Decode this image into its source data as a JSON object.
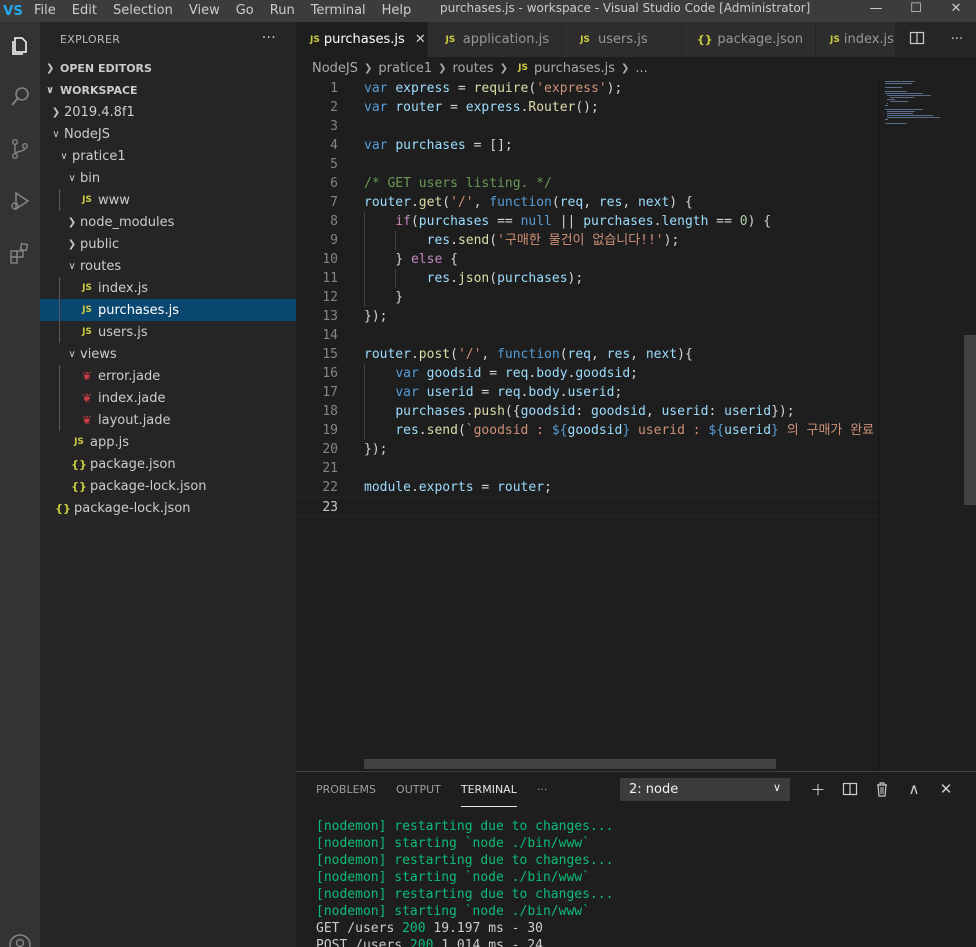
{
  "titlebar": {
    "logo": "VS",
    "menu": [
      "File",
      "Edit",
      "Selection",
      "View",
      "Go",
      "Run",
      "Terminal",
      "Help"
    ],
    "title": "purchases.js - workspace - Visual Studio Code [Administrator]",
    "controls": [
      "minimize-icon",
      "maximize-icon",
      "close-icon"
    ]
  },
  "activitybar": [
    "files-icon",
    "search-icon",
    "source-control-icon",
    "run-debug-icon",
    "extensions-icon",
    "account-icon"
  ],
  "sidebar": {
    "header": "EXPLORER",
    "more": "···",
    "sections": {
      "open_editors": "OPEN EDITORS",
      "workspace": "WORKSPACE"
    },
    "tree": [
      {
        "label": "2019.4.8f1",
        "kind": "folder",
        "expanded": false
      },
      {
        "label": "NodeJS",
        "kind": "folder",
        "expanded": true
      },
      {
        "label": "pratice1",
        "kind": "folder",
        "expanded": true
      },
      {
        "label": "bin",
        "kind": "folder",
        "expanded": true
      },
      {
        "label": "www",
        "kind": "js"
      },
      {
        "label": "node_modules",
        "kind": "folder",
        "expanded": false
      },
      {
        "label": "public",
        "kind": "folder",
        "expanded": false
      },
      {
        "label": "routes",
        "kind": "folder",
        "expanded": true
      },
      {
        "label": "index.js",
        "kind": "js"
      },
      {
        "label": "purchases.js",
        "kind": "js",
        "selected": true
      },
      {
        "label": "users.js",
        "kind": "js"
      },
      {
        "label": "views",
        "kind": "folder",
        "expanded": true
      },
      {
        "label": "error.jade",
        "kind": "jade"
      },
      {
        "label": "index.jade",
        "kind": "jade"
      },
      {
        "label": "layout.jade",
        "kind": "jade"
      },
      {
        "label": "app.js",
        "kind": "js"
      },
      {
        "label": "package.json",
        "kind": "json"
      },
      {
        "label": "package-lock.json",
        "kind": "json"
      },
      {
        "label": "package-lock.json",
        "kind": "json"
      }
    ]
  },
  "tabs": [
    {
      "label": "purchases.js",
      "icon": "JS",
      "active": true,
      "close": "✕"
    },
    {
      "label": "application.js",
      "icon": "JS"
    },
    {
      "label": "users.js",
      "icon": "JS"
    },
    {
      "label": "package.json",
      "icon": "{}"
    },
    {
      "label": "index.js",
      "icon": "JS"
    }
  ],
  "breadcrumb": [
    "NodeJS",
    "pratice1",
    "routes",
    "purchases.js",
    "..."
  ],
  "breadcrumb_file_icon": "JS",
  "editor": {
    "current_line": 23,
    "lines": [
      [
        [
          "kw",
          "var"
        ],
        [
          "t",
          " "
        ],
        [
          "var",
          "express"
        ],
        [
          "t",
          " = "
        ],
        [
          "fn",
          "require"
        ],
        [
          "t",
          "("
        ],
        [
          "str",
          "'express'"
        ],
        [
          "t",
          ");"
        ]
      ],
      [
        [
          "kw",
          "var"
        ],
        [
          "t",
          " "
        ],
        [
          "var",
          "router"
        ],
        [
          "t",
          " = "
        ],
        [
          "var",
          "express"
        ],
        [
          "t",
          "."
        ],
        [
          "fn",
          "Router"
        ],
        [
          "t",
          "();"
        ]
      ],
      [],
      [
        [
          "kw",
          "var"
        ],
        [
          "t",
          " "
        ],
        [
          "var",
          "purchases"
        ],
        [
          "t",
          " = [];"
        ]
      ],
      [],
      [
        [
          "cm",
          "/* GET users listing. */"
        ]
      ],
      [
        [
          "var",
          "router"
        ],
        [
          "t",
          "."
        ],
        [
          "fn",
          "get"
        ],
        [
          "t",
          "("
        ],
        [
          "str",
          "'/'"
        ],
        [
          "t",
          ", "
        ],
        [
          "kw",
          "function"
        ],
        [
          "t",
          "("
        ],
        [
          "var",
          "req"
        ],
        [
          "t",
          ", "
        ],
        [
          "var",
          "res"
        ],
        [
          "t",
          ", "
        ],
        [
          "var",
          "next"
        ],
        [
          "t",
          ") {"
        ]
      ],
      [
        [
          "t",
          "    "
        ],
        [
          "ctl",
          "if"
        ],
        [
          "t",
          "("
        ],
        [
          "var",
          "purchases"
        ],
        [
          "t",
          " == "
        ],
        [
          "kw",
          "null"
        ],
        [
          "t",
          " || "
        ],
        [
          "var",
          "purchases"
        ],
        [
          "t",
          "."
        ],
        [
          "var",
          "length"
        ],
        [
          "t",
          " == "
        ],
        [
          "num",
          "0"
        ],
        [
          "t",
          ") {"
        ]
      ],
      [
        [
          "t",
          "        "
        ],
        [
          "var",
          "res"
        ],
        [
          "t",
          "."
        ],
        [
          "fn",
          "send"
        ],
        [
          "t",
          "("
        ],
        [
          "str",
          "'구매한 물건이 없습니다!!'"
        ],
        [
          "t",
          ");"
        ]
      ],
      [
        [
          "t",
          "    } "
        ],
        [
          "ctl",
          "else"
        ],
        [
          "t",
          " {"
        ]
      ],
      [
        [
          "t",
          "        "
        ],
        [
          "var",
          "res"
        ],
        [
          "t",
          "."
        ],
        [
          "fn",
          "json"
        ],
        [
          "t",
          "("
        ],
        [
          "var",
          "purchases"
        ],
        [
          "t",
          ");"
        ]
      ],
      [
        [
          "t",
          "    }"
        ]
      ],
      [
        [
          "t",
          "});"
        ]
      ],
      [],
      [
        [
          "var",
          "router"
        ],
        [
          "t",
          "."
        ],
        [
          "fn",
          "post"
        ],
        [
          "t",
          "("
        ],
        [
          "str",
          "'/'"
        ],
        [
          "t",
          ", "
        ],
        [
          "kw",
          "function"
        ],
        [
          "t",
          "("
        ],
        [
          "var",
          "req"
        ],
        [
          "t",
          ", "
        ],
        [
          "var",
          "res"
        ],
        [
          "t",
          ", "
        ],
        [
          "var",
          "next"
        ],
        [
          "t",
          "){"
        ]
      ],
      [
        [
          "t",
          "    "
        ],
        [
          "kw",
          "var"
        ],
        [
          "t",
          " "
        ],
        [
          "var",
          "goodsid"
        ],
        [
          "t",
          " = "
        ],
        [
          "var",
          "req"
        ],
        [
          "t",
          "."
        ],
        [
          "var",
          "body"
        ],
        [
          "t",
          "."
        ],
        [
          "var",
          "goodsid"
        ],
        [
          "t",
          ";"
        ]
      ],
      [
        [
          "t",
          "    "
        ],
        [
          "kw",
          "var"
        ],
        [
          "t",
          " "
        ],
        [
          "var",
          "userid"
        ],
        [
          "t",
          " = "
        ],
        [
          "var",
          "req"
        ],
        [
          "t",
          "."
        ],
        [
          "var",
          "body"
        ],
        [
          "t",
          "."
        ],
        [
          "var",
          "userid"
        ],
        [
          "t",
          ";"
        ]
      ],
      [
        [
          "t",
          "    "
        ],
        [
          "var",
          "purchases"
        ],
        [
          "t",
          "."
        ],
        [
          "fn",
          "push"
        ],
        [
          "t",
          "({"
        ],
        [
          "var",
          "goodsid"
        ],
        [
          "t",
          ": "
        ],
        [
          "var",
          "goodsid"
        ],
        [
          "t",
          ", "
        ],
        [
          "var",
          "userid"
        ],
        [
          "t",
          ": "
        ],
        [
          "var",
          "userid"
        ],
        [
          "t",
          "});"
        ]
      ],
      [
        [
          "t",
          "    "
        ],
        [
          "var",
          "res"
        ],
        [
          "t",
          "."
        ],
        [
          "fn",
          "send"
        ],
        [
          "t",
          "("
        ],
        [
          "str",
          "`goodsid : "
        ],
        [
          "kw",
          "${"
        ],
        [
          "var",
          "goodsid"
        ],
        [
          "kw",
          "}"
        ],
        [
          "str",
          " userid : "
        ],
        [
          "kw",
          "${"
        ],
        [
          "var",
          "userid"
        ],
        [
          "kw",
          "}"
        ],
        [
          "str",
          " 의 구매가 완료"
        ]
      ],
      [
        [
          "t",
          "});"
        ]
      ],
      [],
      [
        [
          "var",
          "module"
        ],
        [
          "t",
          "."
        ],
        [
          "var",
          "exports"
        ],
        [
          "t",
          " = "
        ],
        [
          "var",
          "router"
        ],
        [
          "t",
          ";"
        ]
      ],
      []
    ]
  },
  "panel": {
    "tabs": [
      "PROBLEMS",
      "OUTPUT",
      "TERMINAL",
      "···"
    ],
    "active_tab": "TERMINAL",
    "terminal_select": "2: node",
    "actions": [
      "add-terminal-icon",
      "split-terminal-icon",
      "trash-icon",
      "chevron-up-icon",
      "close-icon"
    ],
    "terminal_lines": [
      {
        "kind": "green",
        "text": "[nodemon] restarting due to changes..."
      },
      {
        "kind": "green",
        "text": "[nodemon] starting `node ./bin/www`"
      },
      {
        "kind": "green",
        "text": "[nodemon] restarting due to changes..."
      },
      {
        "kind": "green",
        "text": "[nodemon] starting `node ./bin/www`"
      },
      {
        "kind": "green",
        "text": "[nodemon] restarting due to changes..."
      },
      {
        "kind": "green",
        "text": "[nodemon] starting `node ./bin/www`"
      },
      {
        "kind": "http",
        "pre": "GET /users ",
        "status": "200",
        "post": " 19.197 ms - 30"
      },
      {
        "kind": "http",
        "pre": "POST /users ",
        "status": "200",
        "post": " 1.014 ms - 24"
      }
    ]
  },
  "colors": {
    "accent": "#094771",
    "activity_bar": "#333333",
    "sidebar": "#252526",
    "editor": "#1e1e1e",
    "terminal_green": "#0dbc79"
  }
}
